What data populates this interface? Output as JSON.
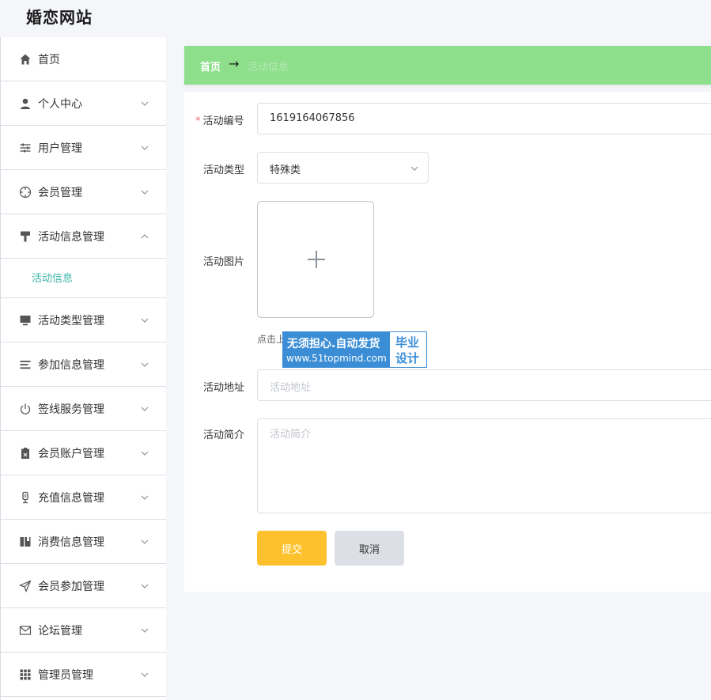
{
  "app": {
    "title": "婚恋网站"
  },
  "sidebar": {
    "items": [
      {
        "label": "首页",
        "icon": "home-icon"
      },
      {
        "label": "个人中心",
        "icon": "user-icon"
      },
      {
        "label": "用户管理",
        "icon": "sliders-icon"
      },
      {
        "label": "会员管理",
        "icon": "crosshair-icon"
      },
      {
        "label": "活动信息管理",
        "icon": "paint-roller-icon",
        "expanded": true
      },
      {
        "label": "活动类型管理",
        "icon": "monitor-icon"
      },
      {
        "label": "参加信息管理",
        "icon": "list-icon"
      },
      {
        "label": "签线服务管理",
        "icon": "power-icon"
      },
      {
        "label": "会员账户管理",
        "icon": "clipboard-x-icon"
      },
      {
        "label": "充值信息管理",
        "icon": "microphone-icon"
      },
      {
        "label": "消费信息管理",
        "icon": "book-icon"
      },
      {
        "label": "会员参加管理",
        "icon": "send-icon"
      },
      {
        "label": "论坛管理",
        "icon": "mail-icon"
      },
      {
        "label": "管理员管理",
        "icon": "grid-icon"
      }
    ],
    "submenu_active": "活动信息"
  },
  "breadcrumb": {
    "home": "首页",
    "separator": "→",
    "current": "活动信息"
  },
  "form": {
    "code": {
      "label": "活动编号",
      "required_mark": "*",
      "value": "1619164067856"
    },
    "type": {
      "label": "活动类型",
      "value": "特殊类"
    },
    "image": {
      "label": "活动图片",
      "tip": "点击上"
    },
    "address": {
      "label": "活动地址",
      "placeholder": "活动地址"
    },
    "intro": {
      "label": "活动简介",
      "placeholder": "活动简介"
    },
    "submit_label": "提交",
    "cancel_label": "取消"
  },
  "watermark": {
    "line1": "无须担心.自动发货",
    "line2": "www.51topmind.com",
    "right1": "毕业",
    "right2": "设计"
  },
  "colors": {
    "accent": "#3bb5a8",
    "breadcrumb_bg": "#8ddf8b",
    "submit": "#fdc12d",
    "required": "#f56c6c"
  }
}
